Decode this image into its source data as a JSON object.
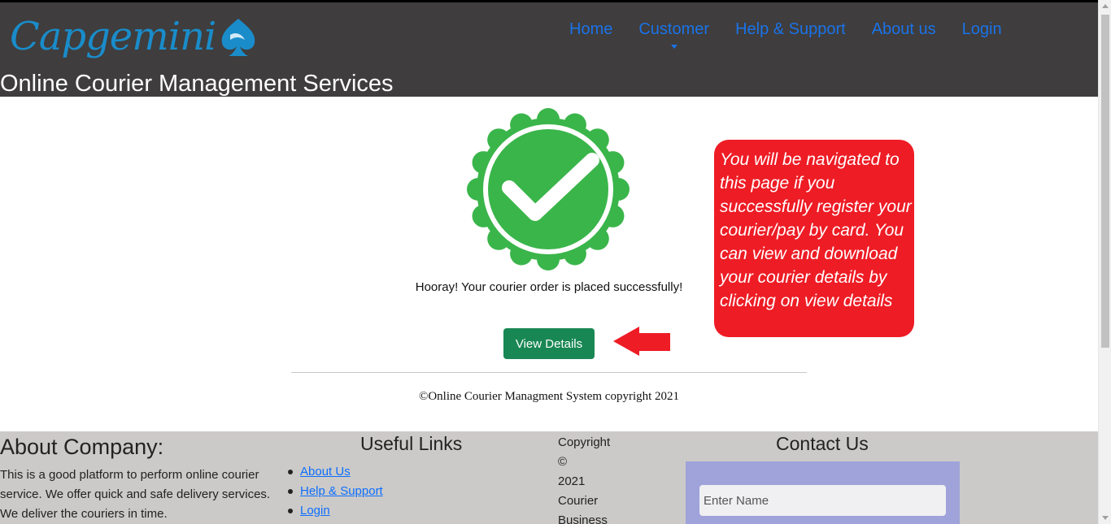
{
  "header": {
    "logo_text": "Capgemini",
    "logo_icon": "spade-icon",
    "site_title": "Online Courier Management Services",
    "nav": {
      "home": "Home",
      "customer": "Customer",
      "help": "Help & Support",
      "about": "About us",
      "login": "Login"
    }
  },
  "main": {
    "success_icon": "check-badge-icon",
    "success_message": "Hooray! Your courier order is placed successfully!",
    "view_details_label": "View Details",
    "annotation_text": "You will be navigated to this page if you successfully register your courier/pay by card. You can view and download your courier details by clicking on view details",
    "copyright_line": "©Online Courier Managment System copyright 2021"
  },
  "footer": {
    "about_title": "About Company:",
    "about_text": "This is a good platform to perform online courier service. We offer quick and safe delivery services. We deliver the couriers in time.",
    "links_title": "Useful Links",
    "links": [
      "About Us",
      "Help & Support",
      "Login"
    ],
    "copyright_words": [
      "Copyright",
      "©",
      "2021",
      "Courier",
      "Business"
    ],
    "contact_title": "Contact Us",
    "name_placeholder": "Enter Name"
  },
  "colors": {
    "header_bg": "#3f3d3d",
    "nav_link": "#1a73e8",
    "logo": "#1a8cca",
    "success_green": "#3ab54a",
    "button_green": "#198754",
    "annotation_red": "#ee1c25",
    "footer_bg": "#cccac8",
    "contact_box": "#9fa3da"
  }
}
